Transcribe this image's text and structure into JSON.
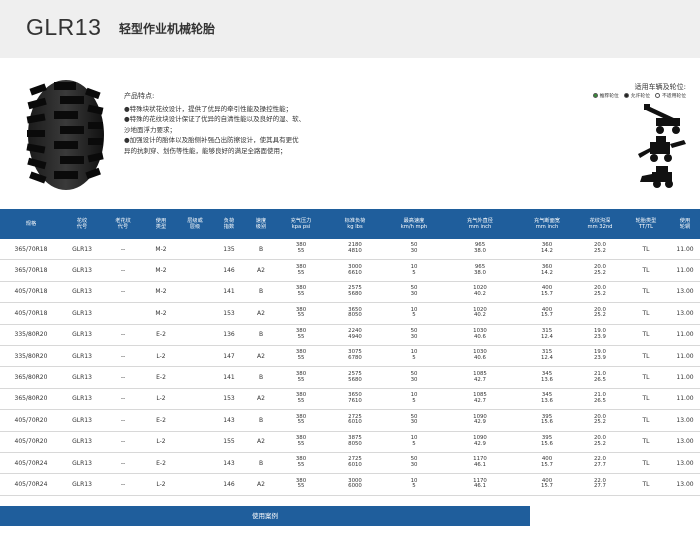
{
  "page": {
    "model": "GLR13",
    "subtitle": "轻型作业机械轮胎"
  },
  "features": {
    "title": "产品特点:",
    "items": [
      "●特殊块状花纹设计，提供了优异的牵引性能及操控性能；",
      "●特殊的花纹块设计保证了优异的自清性能以及良好的湿、软、",
      "沙地面浮力要求；",
      "●加强设计的胎体以及胎侧补强凸出防擦设计，使其具有更优",
      "异的抗刺穿、划伤等性能，能够良好的满足全路面使用；"
    ]
  },
  "application": {
    "title": "适用车辆及轮位:",
    "legend": [
      {
        "label": "推荐轮位",
        "fill": "#3a8a3a"
      },
      {
        "label": "允许轮位",
        "fill": "#222222"
      },
      {
        "label": "不适用轮位",
        "fill": "#ffffff"
      }
    ],
    "vehicles": [
      "telehandler-icon",
      "backhoe-loader-icon",
      "skid-steer-loader-icon"
    ]
  },
  "table": {
    "headers": [
      "规格",
      "花纹\n代号",
      "老花纹\n代号",
      "使用\n类型",
      "层级或\n层级",
      "负荷\n指数",
      "速度\n级别",
      "充气压力\nkpa psi",
      "标准负荷\nkg lbs",
      "最高速度\nkm/h mph",
      "充气外直径\nmm inch",
      "充气断面宽\nmm inch",
      "花纹沟深\nmm 32nd",
      "轮胎类型\nTT/TL",
      "使用\n轮辋"
    ],
    "rows": [
      [
        "365/70R18",
        "GLR13",
        "--",
        "M-2",
        "",
        "135",
        "B",
        "380\n55",
        "2180\n4810",
        "50\n30",
        "965\n38.0",
        "360\n14.2",
        "20.0\n25.2",
        "TL",
        "11.00"
      ],
      [
        "365/70R18",
        "GLR13",
        "--",
        "M-2",
        "",
        "146",
        "A2",
        "380\n55",
        "3000\n6610",
        "10\n5",
        "965\n38.0",
        "360\n14.2",
        "20.0\n25.2",
        "TL",
        "11.00"
      ],
      [
        "405/70R18",
        "GLR13",
        "--",
        "M-2",
        "",
        "141",
        "B",
        "380\n55",
        "2575\n5680",
        "50\n30",
        "1020\n40.2",
        "400\n15.7",
        "20.0\n25.2",
        "TL",
        "13.00"
      ],
      [
        "405/70R18",
        "GLR13",
        "",
        "M-2",
        "",
        "153",
        "A2",
        "380\n55",
        "3650\n8050",
        "10\n5",
        "1020\n40.2",
        "400\n15.7",
        "20.0\n25.2",
        "TL",
        "13.00"
      ],
      [
        "335/80R20",
        "GLR13",
        "--",
        "E-2",
        "",
        "136",
        "B",
        "380\n55",
        "2240\n4940",
        "50\n30",
        "1030\n40.6",
        "315\n12.4",
        "19.0\n23.9",
        "TL",
        "11.00"
      ],
      [
        "335/80R20",
        "GLR13",
        "--",
        "L-2",
        "",
        "147",
        "A2",
        "380\n55",
        "3075\n6780",
        "10\n5",
        "1030\n40.6",
        "315\n12.4",
        "19.0\n23.9",
        "TL",
        "11.00"
      ],
      [
        "365/80R20",
        "GLR13",
        "--",
        "E-2",
        "",
        "141",
        "B",
        "380\n55",
        "2575\n5680",
        "50\n30",
        "1085\n42.7",
        "345\n13.6",
        "21.0\n26.5",
        "TL",
        "11.00"
      ],
      [
        "365/80R20",
        "GLR13",
        "--",
        "L-2",
        "",
        "153",
        "A2",
        "380\n55",
        "3650\n7610",
        "10\n5",
        "1085\n42.7",
        "345\n13.6",
        "21.0\n26.5",
        "TL",
        "11.00"
      ],
      [
        "405/70R20",
        "GLR13",
        "--",
        "E-2",
        "",
        "143",
        "B",
        "380\n55",
        "2725\n6010",
        "50\n30",
        "1090\n42.9",
        "395\n15.6",
        "20.0\n25.2",
        "TL",
        "13.00"
      ],
      [
        "405/70R20",
        "GLR13",
        "--",
        "L-2",
        "",
        "155",
        "A2",
        "380\n55",
        "3875\n8050",
        "10\n5",
        "1090\n42.9",
        "395\n15.6",
        "20.0\n25.2",
        "TL",
        "13.00"
      ],
      [
        "405/70R24",
        "GLR13",
        "--",
        "E-2",
        "",
        "143",
        "B",
        "380\n55",
        "2725\n6010",
        "50\n30",
        "1170\n46.1",
        "400\n15.7",
        "22.0\n27.7",
        "TL",
        "13.00"
      ],
      [
        "405/70R24",
        "GLR13",
        "--",
        "L-2",
        "",
        "146",
        "A2",
        "380\n55",
        "3000\n6000",
        "10\n5",
        "1170\n46.1",
        "400\n15.7",
        "22.0\n27.7",
        "TL",
        "13.00"
      ]
    ]
  },
  "footer": {
    "button_label": "使用案例"
  },
  "colors": {
    "header_bg": "#efefef",
    "accent": "#1f5e9c"
  }
}
